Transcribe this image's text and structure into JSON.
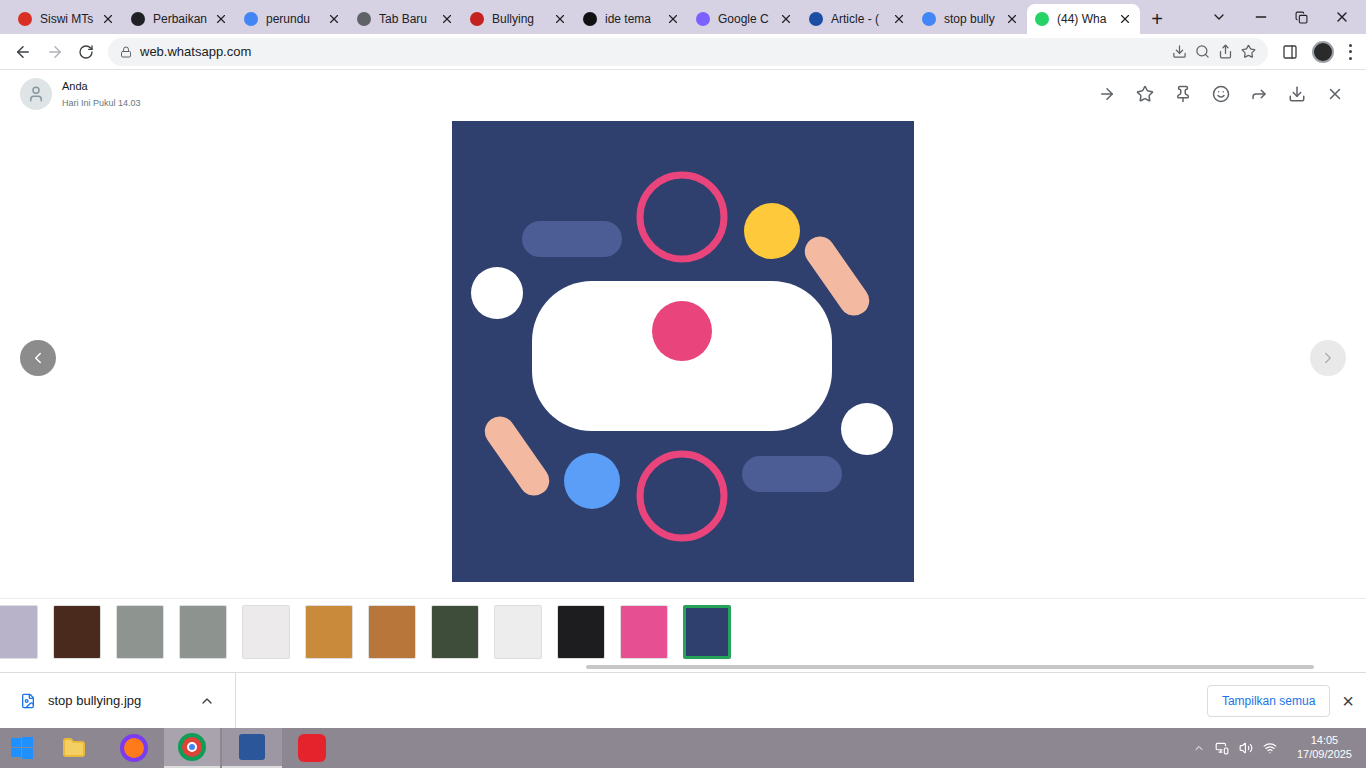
{
  "tabs": [
    {
      "label": "Siswi MTs",
      "selected": false,
      "color": "#d93025"
    },
    {
      "label": "Perbaikan",
      "selected": false,
      "color": "#202124"
    },
    {
      "label": "perundu",
      "selected": false,
      "color": "#4285f4"
    },
    {
      "label": "Tab Baru",
      "selected": false,
      "color": "#5f6368"
    },
    {
      "label": "Bullying",
      "selected": false,
      "color": "#c5221f"
    },
    {
      "label": "ide tema",
      "selected": false,
      "color": "#111111"
    },
    {
      "label": "Google C",
      "selected": false,
      "color": "#7b61ff"
    },
    {
      "label": "Article - (",
      "selected": false,
      "color": "#1a4fa3"
    },
    {
      "label": "stop bully",
      "selected": false,
      "color": "#4285f4"
    },
    {
      "label": "(44) Wha",
      "selected": true,
      "color": "#25d366"
    }
  ],
  "new_tab": "+",
  "address_bar": {
    "url": "web.whatsapp.com"
  },
  "viewer": {
    "sender": "Anda",
    "time": "Hari Ini Pukul 14.03"
  },
  "thumbnails": [
    {
      "selected": false,
      "color": "#b9b3c9"
    },
    {
      "selected": false,
      "color": "#4a2a1c"
    },
    {
      "selected": false,
      "color": "#8e9591"
    },
    {
      "selected": false,
      "color": "#8d938f"
    },
    {
      "selected": false,
      "color": "#eceaea"
    },
    {
      "selected": false,
      "color": "#c98a3c"
    },
    {
      "selected": false,
      "color": "#b8763a"
    },
    {
      "selected": false,
      "color": "#3d4d39"
    },
    {
      "selected": false,
      "color": "#ededed"
    },
    {
      "selected": false,
      "color": "#1d1d1f"
    },
    {
      "selected": false,
      "color": "#e64f92"
    },
    {
      "selected": true,
      "color": "#2f3f6e"
    }
  ],
  "download_bar": {
    "file": "stop bullying.jpg",
    "show_all": "Tampilkan semua",
    "close": "×"
  },
  "taskbar": {
    "time": "14:05",
    "date": "17/09/2025"
  }
}
